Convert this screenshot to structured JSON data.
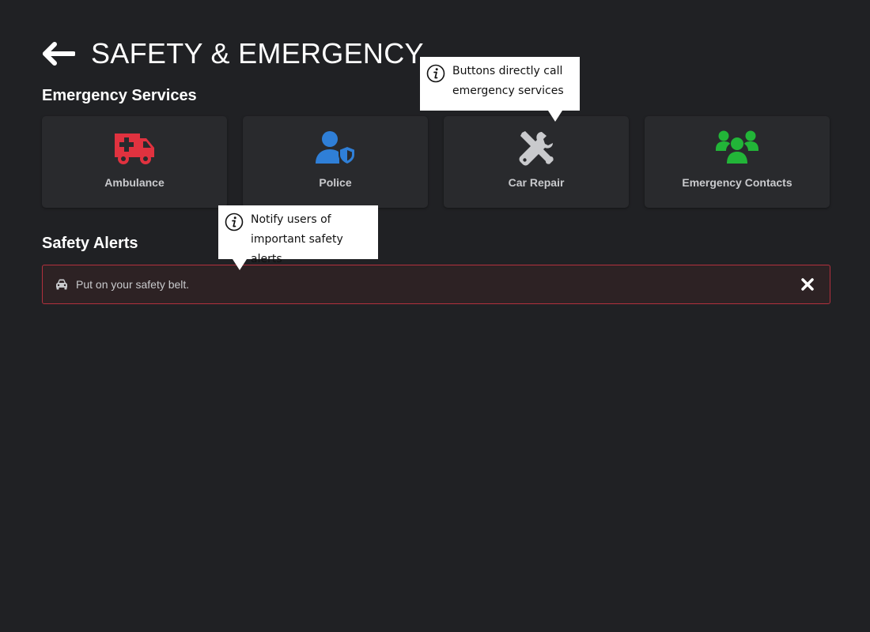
{
  "header": {
    "title": "SAFETY & EMERGENCY"
  },
  "services": {
    "title": "Emergency Services",
    "items": [
      {
        "label": "Ambulance",
        "icon": "ambulance-icon",
        "color": "#e0323f"
      },
      {
        "label": "Police",
        "icon": "police-icon",
        "color": "#2f7fd7"
      },
      {
        "label": "Car Repair",
        "icon": "car-repair-icon",
        "color": "#c9cacd"
      },
      {
        "label": "Emergency Contacts",
        "icon": "emergency-contacts-icon",
        "color": "#22b538"
      }
    ]
  },
  "alerts": {
    "title": "Safety Alerts",
    "items": [
      {
        "text": "Put on your safety belt.",
        "icon": "car-icon",
        "border_color": "#b2303d"
      }
    ]
  },
  "annotations": [
    {
      "text": "Buttons directly call emergency services",
      "icon": "info-icon"
    },
    {
      "text": "Notify users of important safety alerts",
      "icon": "info-icon"
    }
  ]
}
